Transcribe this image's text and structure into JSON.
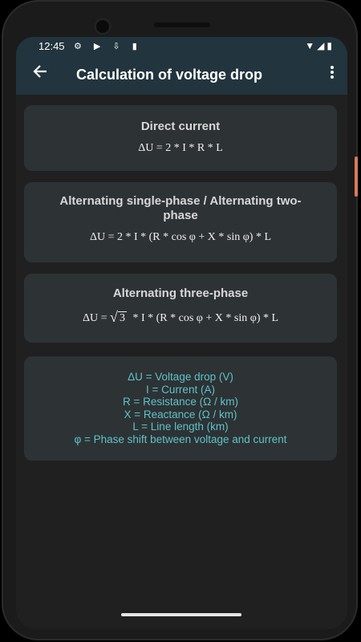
{
  "status": {
    "time": "12:45",
    "left_icons": "⚙ ▶ ⇩ ▮",
    "right_icons": "▼◢▮"
  },
  "appbar": {
    "title": "Calculation of voltage drop",
    "back_icon": "arrow-back-icon",
    "menu_icon": "more-vert-icon"
  },
  "cards": [
    {
      "title": "Direct current",
      "formula": "ΔU = 2 * I * R * L"
    },
    {
      "title": "Alternating single-phase / Alternating two-phase",
      "formula": "ΔU = 2 * I * (R * cos φ + X * sin φ) * L"
    },
    {
      "title": "Alternating three-phase",
      "formula_prefix": "ΔU =",
      "formula_root": "3",
      "formula_suffix": "* I * (R * cos φ + X * sin φ) * L"
    }
  ],
  "legend": [
    "ΔU = Voltage drop (V)",
    "I = Current (A)",
    "R = Resistance (Ω / km)",
    "X = Reactance (Ω / km)",
    "L = Line length (km)",
    "φ = Phase shift between voltage and current"
  ],
  "colors": {
    "appbar": "#22343d",
    "card": "#2d3235",
    "legend_text": "#5fc3c7",
    "background": "#202020"
  }
}
